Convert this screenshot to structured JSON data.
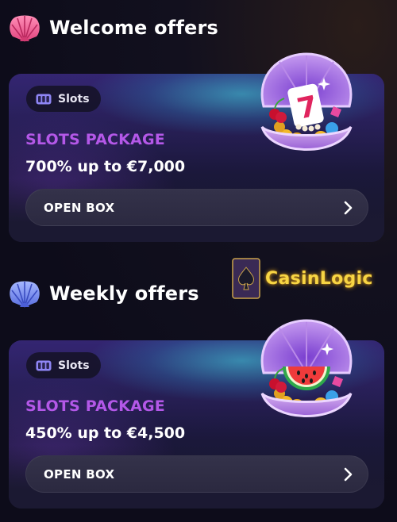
{
  "sections": [
    {
      "title": "Welcome offers",
      "shell_color": "#f0609a",
      "card": {
        "badge_label": "Slots",
        "package_title": "SLOTS PACKAGE",
        "offer": "700% up to €7,000",
        "button_label": "OPEN BOX",
        "prize_icon": "lucky-seven-icon"
      }
    },
    {
      "title": "Weekly offers",
      "shell_color": "#5a8cf0",
      "card": {
        "badge_label": "Slots",
        "package_title": "SLOTS PACKAGE",
        "offer": "450% up to €4,500",
        "button_label": "OPEN BOX",
        "prize_icon": "watermelon-icon"
      }
    }
  ],
  "watermark": {
    "brand": "CasinLogic"
  },
  "colors": {
    "accent_purple": "#b458e8",
    "background": "#0d0c1a",
    "button_bg": "#2f2d44"
  }
}
